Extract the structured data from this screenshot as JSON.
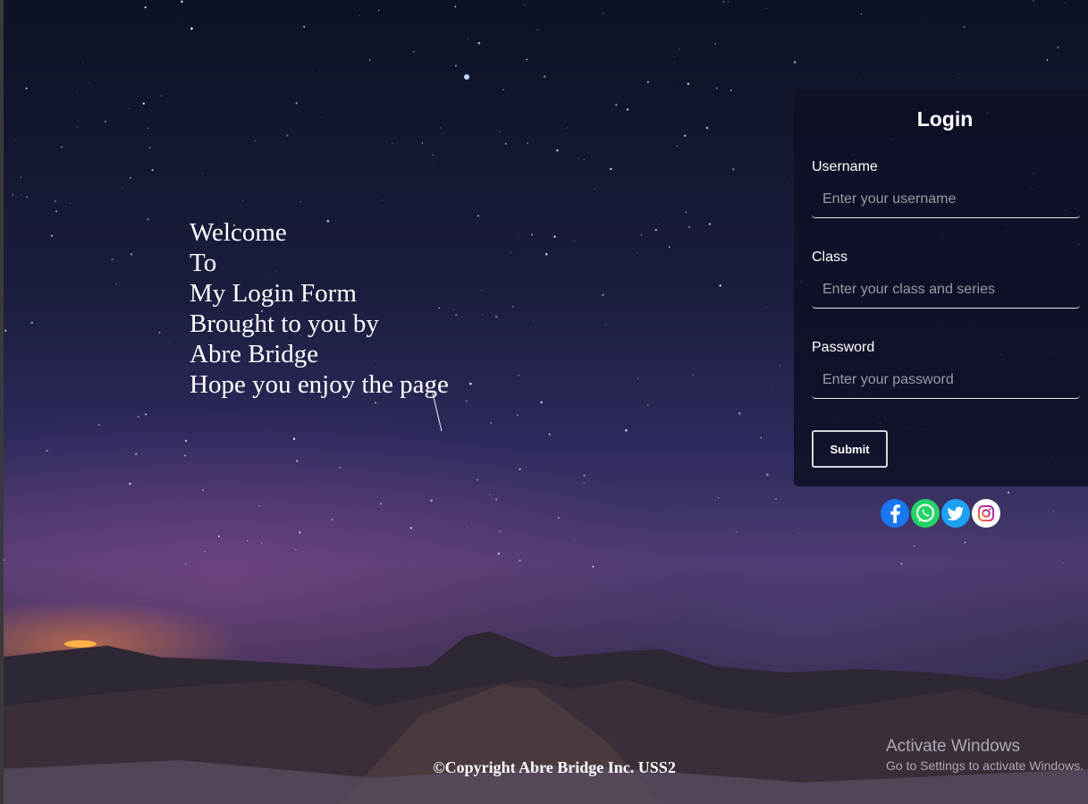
{
  "welcome": {
    "lines": [
      "Welcome",
      "To",
      "My Login Form",
      "Brought to you by",
      "Abre Bridge",
      "Hope you enjoy the page"
    ]
  },
  "login": {
    "title": "Login",
    "username_label": "Username",
    "username_placeholder": "Enter your username",
    "class_label": "Class",
    "class_placeholder": "Enter your class and series",
    "password_label": "Password",
    "password_placeholder": "Enter your password",
    "submit_label": "Submit"
  },
  "socials": [
    "facebook-icon",
    "whatsapp-icon",
    "twitter-icon",
    "instagram-icon"
  ],
  "footer": {
    "copyright": "©Copyright Abre Bridge Inc. USS2"
  },
  "watermark": {
    "title": "Activate Windows",
    "subtitle": "Go to Settings to activate Windows."
  },
  "colors": {
    "facebook": "#1877f2",
    "whatsapp": "#25d366",
    "twitter": "#1da1f2",
    "instagram": "#e1306c",
    "panel": "#0e1026"
  }
}
